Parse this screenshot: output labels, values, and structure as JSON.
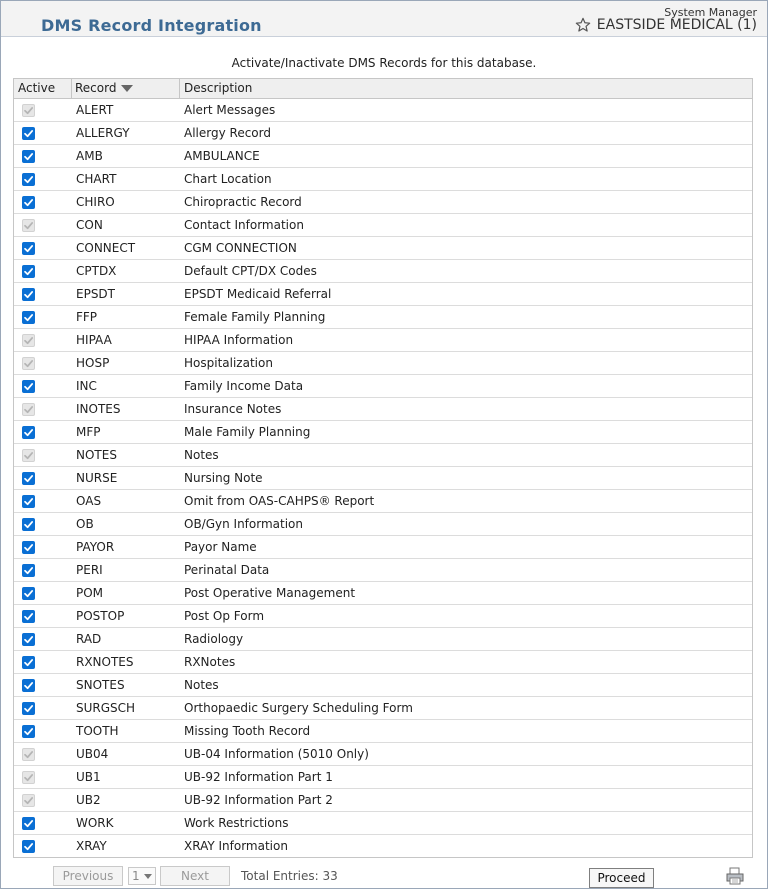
{
  "header": {
    "title": "DMS Record Integration",
    "system_label": "System Manager",
    "practice": "EASTSIDE MEDICAL (1)",
    "icon": "star-icon"
  },
  "subtitle": "Activate/Inactivate DMS Records for this database.",
  "table": {
    "columns": [
      "Active",
      "Record",
      "Description"
    ],
    "sort_icon": "sort-desc-icon",
    "rows": [
      {
        "active": false,
        "record": "ALERT",
        "description": "Alert Messages"
      },
      {
        "active": true,
        "record": "ALLERGY",
        "description": "Allergy Record"
      },
      {
        "active": true,
        "record": "AMB",
        "description": "AMBULANCE"
      },
      {
        "active": true,
        "record": "CHART",
        "description": "Chart Location"
      },
      {
        "active": true,
        "record": "CHIRO",
        "description": "Chiropractic Record"
      },
      {
        "active": false,
        "record": "CON",
        "description": "Contact Information"
      },
      {
        "active": true,
        "record": "CONNECT",
        "description": "CGM CONNECTION"
      },
      {
        "active": true,
        "record": "CPTDX",
        "description": "Default CPT/DX Codes"
      },
      {
        "active": true,
        "record": "EPSDT",
        "description": "EPSDT Medicaid Referral"
      },
      {
        "active": true,
        "record": "FFP",
        "description": "Female Family Planning"
      },
      {
        "active": false,
        "record": "HIPAA",
        "description": "HIPAA Information"
      },
      {
        "active": false,
        "record": "HOSP",
        "description": "Hospitalization"
      },
      {
        "active": true,
        "record": "INC",
        "description": "Family Income Data"
      },
      {
        "active": false,
        "record": "INOTES",
        "description": "Insurance Notes"
      },
      {
        "active": true,
        "record": "MFP",
        "description": "Male Family Planning"
      },
      {
        "active": false,
        "record": "NOTES",
        "description": "Notes"
      },
      {
        "active": true,
        "record": "NURSE",
        "description": "Nursing Note"
      },
      {
        "active": true,
        "record": "OAS",
        "description": "Omit from OAS-CAHPS® Report"
      },
      {
        "active": true,
        "record": "OB",
        "description": "OB/Gyn Information"
      },
      {
        "active": true,
        "record": "PAYOR",
        "description": "Payor Name"
      },
      {
        "active": true,
        "record": "PERI",
        "description": "Perinatal Data"
      },
      {
        "active": true,
        "record": "POM",
        "description": "Post Operative Management"
      },
      {
        "active": true,
        "record": "POSTOP",
        "description": "Post Op Form"
      },
      {
        "active": true,
        "record": "RAD",
        "description": "Radiology"
      },
      {
        "active": true,
        "record": "RXNOTES",
        "description": "RXNotes"
      },
      {
        "active": true,
        "record": "SNOTES",
        "description": "Notes"
      },
      {
        "active": true,
        "record": "SURGSCH",
        "description": "Orthopaedic Surgery Scheduling Form"
      },
      {
        "active": true,
        "record": "TOOTH",
        "description": "Missing Tooth Record"
      },
      {
        "active": false,
        "record": "UB04",
        "description": "UB-04 Information (5010 Only)"
      },
      {
        "active": false,
        "record": "UB1",
        "description": "UB-92 Information Part 1"
      },
      {
        "active": false,
        "record": "UB2",
        "description": "UB-92 Information Part 2"
      },
      {
        "active": true,
        "record": "WORK",
        "description": "Work Restrictions"
      },
      {
        "active": true,
        "record": "XRAY",
        "description": "XRAY Information"
      }
    ]
  },
  "footer": {
    "previous_label": "Previous",
    "page_value": "1",
    "next_label": "Next",
    "total_label": "Total Entries: 33",
    "proceed_label": "Proceed",
    "print_icon": "printer-icon"
  },
  "colors": {
    "title": "#3d6a94",
    "checkbox_active": "#0a6fd4",
    "checkbox_disabled": "#e6e6e6"
  }
}
